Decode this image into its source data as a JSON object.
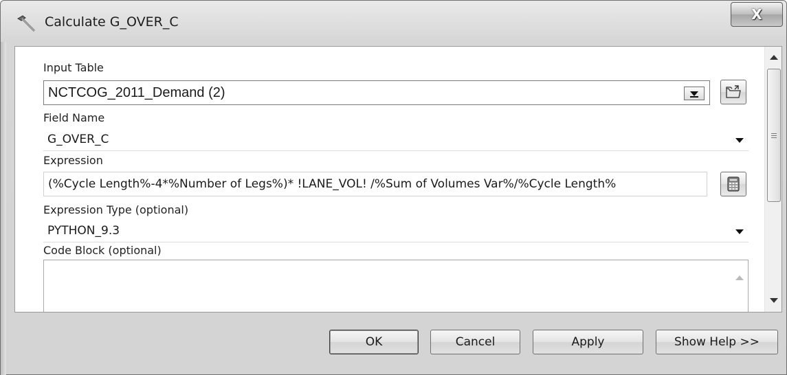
{
  "window": {
    "title": "Calculate G_OVER_C",
    "close_glyph": "X"
  },
  "form": {
    "input_table": {
      "label": "Input Table",
      "value": "NCTCOG_2011_Demand (2)"
    },
    "field_name": {
      "label": "Field Name",
      "value": "G_OVER_C"
    },
    "expression": {
      "label": "Expression",
      "value": "(%Cycle Length%-4*%Number of Legs%)* !LANE_VOL! /%Sum of Volumes Var%/%Cycle Length%"
    },
    "expression_type": {
      "label": "Expression Type (optional)",
      "value": "PYTHON_9.3"
    },
    "code_block": {
      "label": "Code Block (optional)",
      "value": ""
    }
  },
  "buttons": {
    "ok": "OK",
    "cancel": "Cancel",
    "apply": "Apply",
    "help": "Show Help >>"
  },
  "icons": {
    "app": "hammer-icon",
    "browse": "folder-open-icon",
    "calculator": "calculator-icon"
  }
}
